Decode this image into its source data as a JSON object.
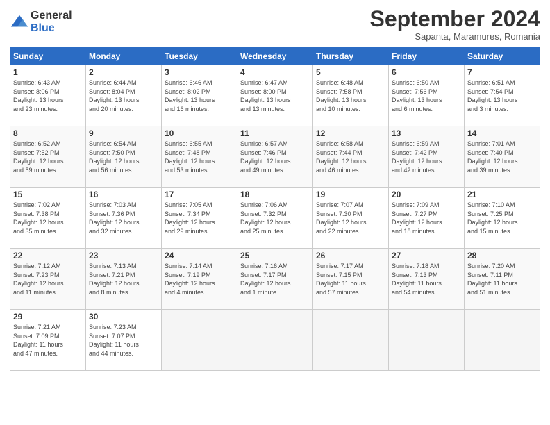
{
  "header": {
    "logo_line1": "General",
    "logo_line2": "Blue",
    "month": "September 2024",
    "location": "Sapanta, Maramures, Romania"
  },
  "days_of_week": [
    "Sunday",
    "Monday",
    "Tuesday",
    "Wednesday",
    "Thursday",
    "Friday",
    "Saturday"
  ],
  "weeks": [
    [
      {
        "day": 1,
        "info": "Sunrise: 6:43 AM\nSunset: 8:06 PM\nDaylight: 13 hours\nand 23 minutes."
      },
      {
        "day": 2,
        "info": "Sunrise: 6:44 AM\nSunset: 8:04 PM\nDaylight: 13 hours\nand 20 minutes."
      },
      {
        "day": 3,
        "info": "Sunrise: 6:46 AM\nSunset: 8:02 PM\nDaylight: 13 hours\nand 16 minutes."
      },
      {
        "day": 4,
        "info": "Sunrise: 6:47 AM\nSunset: 8:00 PM\nDaylight: 13 hours\nand 13 minutes."
      },
      {
        "day": 5,
        "info": "Sunrise: 6:48 AM\nSunset: 7:58 PM\nDaylight: 13 hours\nand 10 minutes."
      },
      {
        "day": 6,
        "info": "Sunrise: 6:50 AM\nSunset: 7:56 PM\nDaylight: 13 hours\nand 6 minutes."
      },
      {
        "day": 7,
        "info": "Sunrise: 6:51 AM\nSunset: 7:54 PM\nDaylight: 13 hours\nand 3 minutes."
      }
    ],
    [
      {
        "day": 8,
        "info": "Sunrise: 6:52 AM\nSunset: 7:52 PM\nDaylight: 12 hours\nand 59 minutes."
      },
      {
        "day": 9,
        "info": "Sunrise: 6:54 AM\nSunset: 7:50 PM\nDaylight: 12 hours\nand 56 minutes."
      },
      {
        "day": 10,
        "info": "Sunrise: 6:55 AM\nSunset: 7:48 PM\nDaylight: 12 hours\nand 53 minutes."
      },
      {
        "day": 11,
        "info": "Sunrise: 6:57 AM\nSunset: 7:46 PM\nDaylight: 12 hours\nand 49 minutes."
      },
      {
        "day": 12,
        "info": "Sunrise: 6:58 AM\nSunset: 7:44 PM\nDaylight: 12 hours\nand 46 minutes."
      },
      {
        "day": 13,
        "info": "Sunrise: 6:59 AM\nSunset: 7:42 PM\nDaylight: 12 hours\nand 42 minutes."
      },
      {
        "day": 14,
        "info": "Sunrise: 7:01 AM\nSunset: 7:40 PM\nDaylight: 12 hours\nand 39 minutes."
      }
    ],
    [
      {
        "day": 15,
        "info": "Sunrise: 7:02 AM\nSunset: 7:38 PM\nDaylight: 12 hours\nand 35 minutes."
      },
      {
        "day": 16,
        "info": "Sunrise: 7:03 AM\nSunset: 7:36 PM\nDaylight: 12 hours\nand 32 minutes."
      },
      {
        "day": 17,
        "info": "Sunrise: 7:05 AM\nSunset: 7:34 PM\nDaylight: 12 hours\nand 29 minutes."
      },
      {
        "day": 18,
        "info": "Sunrise: 7:06 AM\nSunset: 7:32 PM\nDaylight: 12 hours\nand 25 minutes."
      },
      {
        "day": 19,
        "info": "Sunrise: 7:07 AM\nSunset: 7:30 PM\nDaylight: 12 hours\nand 22 minutes."
      },
      {
        "day": 20,
        "info": "Sunrise: 7:09 AM\nSunset: 7:27 PM\nDaylight: 12 hours\nand 18 minutes."
      },
      {
        "day": 21,
        "info": "Sunrise: 7:10 AM\nSunset: 7:25 PM\nDaylight: 12 hours\nand 15 minutes."
      }
    ],
    [
      {
        "day": 22,
        "info": "Sunrise: 7:12 AM\nSunset: 7:23 PM\nDaylight: 12 hours\nand 11 minutes."
      },
      {
        "day": 23,
        "info": "Sunrise: 7:13 AM\nSunset: 7:21 PM\nDaylight: 12 hours\nand 8 minutes."
      },
      {
        "day": 24,
        "info": "Sunrise: 7:14 AM\nSunset: 7:19 PM\nDaylight: 12 hours\nand 4 minutes."
      },
      {
        "day": 25,
        "info": "Sunrise: 7:16 AM\nSunset: 7:17 PM\nDaylight: 12 hours\nand 1 minute."
      },
      {
        "day": 26,
        "info": "Sunrise: 7:17 AM\nSunset: 7:15 PM\nDaylight: 11 hours\nand 57 minutes."
      },
      {
        "day": 27,
        "info": "Sunrise: 7:18 AM\nSunset: 7:13 PM\nDaylight: 11 hours\nand 54 minutes."
      },
      {
        "day": 28,
        "info": "Sunrise: 7:20 AM\nSunset: 7:11 PM\nDaylight: 11 hours\nand 51 minutes."
      }
    ],
    [
      {
        "day": 29,
        "info": "Sunrise: 7:21 AM\nSunset: 7:09 PM\nDaylight: 11 hours\nand 47 minutes."
      },
      {
        "day": 30,
        "info": "Sunrise: 7:23 AM\nSunset: 7:07 PM\nDaylight: 11 hours\nand 44 minutes."
      },
      null,
      null,
      null,
      null,
      null
    ]
  ]
}
